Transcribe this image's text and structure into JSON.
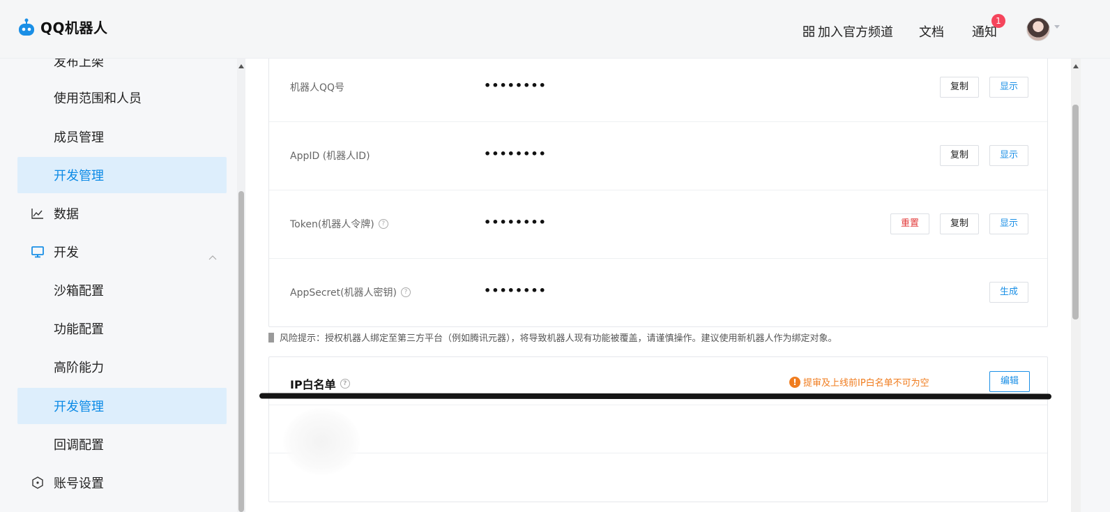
{
  "header": {
    "app_name": "QQ机器人",
    "nav": {
      "join_channel": "加入官方频道",
      "docs": "文档",
      "notice": "通知",
      "notice_badge": "1"
    }
  },
  "sidebar": {
    "items": [
      {
        "label": "发布上架",
        "icon": null
      },
      {
        "label": "使用范围和人员",
        "icon": null
      },
      {
        "label": "成员管理",
        "icon": null
      },
      {
        "label": "开发管理",
        "icon": null,
        "active": true
      },
      {
        "label": "数据",
        "icon": "chart-line-icon"
      },
      {
        "label": "开发",
        "icon": "monitor-icon",
        "expanded": true
      },
      {
        "label": "沙箱配置",
        "icon": null
      },
      {
        "label": "功能配置",
        "icon": null
      },
      {
        "label": "高阶能力",
        "icon": null
      },
      {
        "label": "开发管理",
        "icon": null,
        "active": true
      },
      {
        "label": "回调配置",
        "icon": null
      },
      {
        "label": "账号设置",
        "icon": "hexagon-icon"
      }
    ]
  },
  "credentials": {
    "rows": [
      {
        "label": "机器人QQ号",
        "value": "••••••••",
        "copy": "复制",
        "show": "显示"
      },
      {
        "label": "AppID (机器人ID)",
        "value": "••••••••",
        "copy": "复制",
        "show": "显示"
      },
      {
        "label": "Token(机器人令牌)",
        "value": "••••••••",
        "reset": "重置",
        "copy": "复制",
        "show": "显示"
      },
      {
        "label": "AppSecret(机器人密钥)",
        "value": "••••••••",
        "generate": "生成"
      }
    ],
    "help_glyph": "?"
  },
  "risk_notice": "风险提示：授权机器人绑定至第三方平台（例如腾讯元器），将导致机器人现有功能被覆盖，请谨慎操作。建议使用新机器人作为绑定对象。",
  "ip_whitelist": {
    "title": "IP白名单",
    "warning": "提审及上线前IP白名单不可为空",
    "warning_glyph": "!",
    "edit": "编辑"
  },
  "colors": {
    "accent": "#1a8fe6",
    "active_bg": "#ddeefc",
    "danger": "#e23b3b",
    "warning": "#f07c1e",
    "badge": "#f5455c"
  }
}
